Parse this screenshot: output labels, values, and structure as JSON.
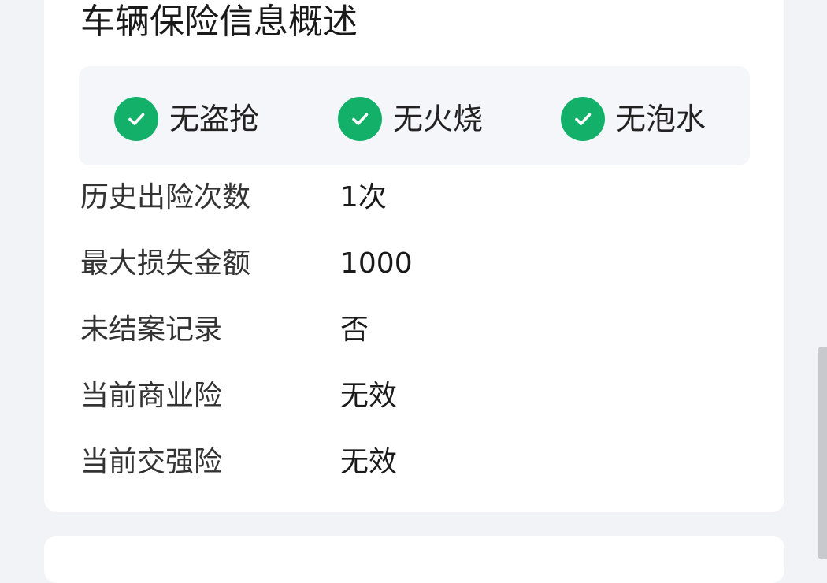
{
  "section": {
    "title": "车辆保险信息概述"
  },
  "badges": [
    {
      "label": "无盗抢",
      "icon": "check-circle-icon"
    },
    {
      "label": "无火烧",
      "icon": "check-circle-icon"
    },
    {
      "label": "无泡水",
      "icon": "check-circle-icon"
    }
  ],
  "details": [
    {
      "label": "历史出险次数",
      "value": "1次"
    },
    {
      "label": "最大损失金额",
      "value": "1000"
    },
    {
      "label": "未结案记录",
      "value": "否"
    },
    {
      "label": "当前商业险",
      "value": "无效"
    },
    {
      "label": "当前交强险",
      "value": "无效"
    }
  ],
  "colors": {
    "accent": "#13b06a",
    "background": "#f2f3f7",
    "card": "#ffffff",
    "badge_panel": "#f5f6f9"
  }
}
